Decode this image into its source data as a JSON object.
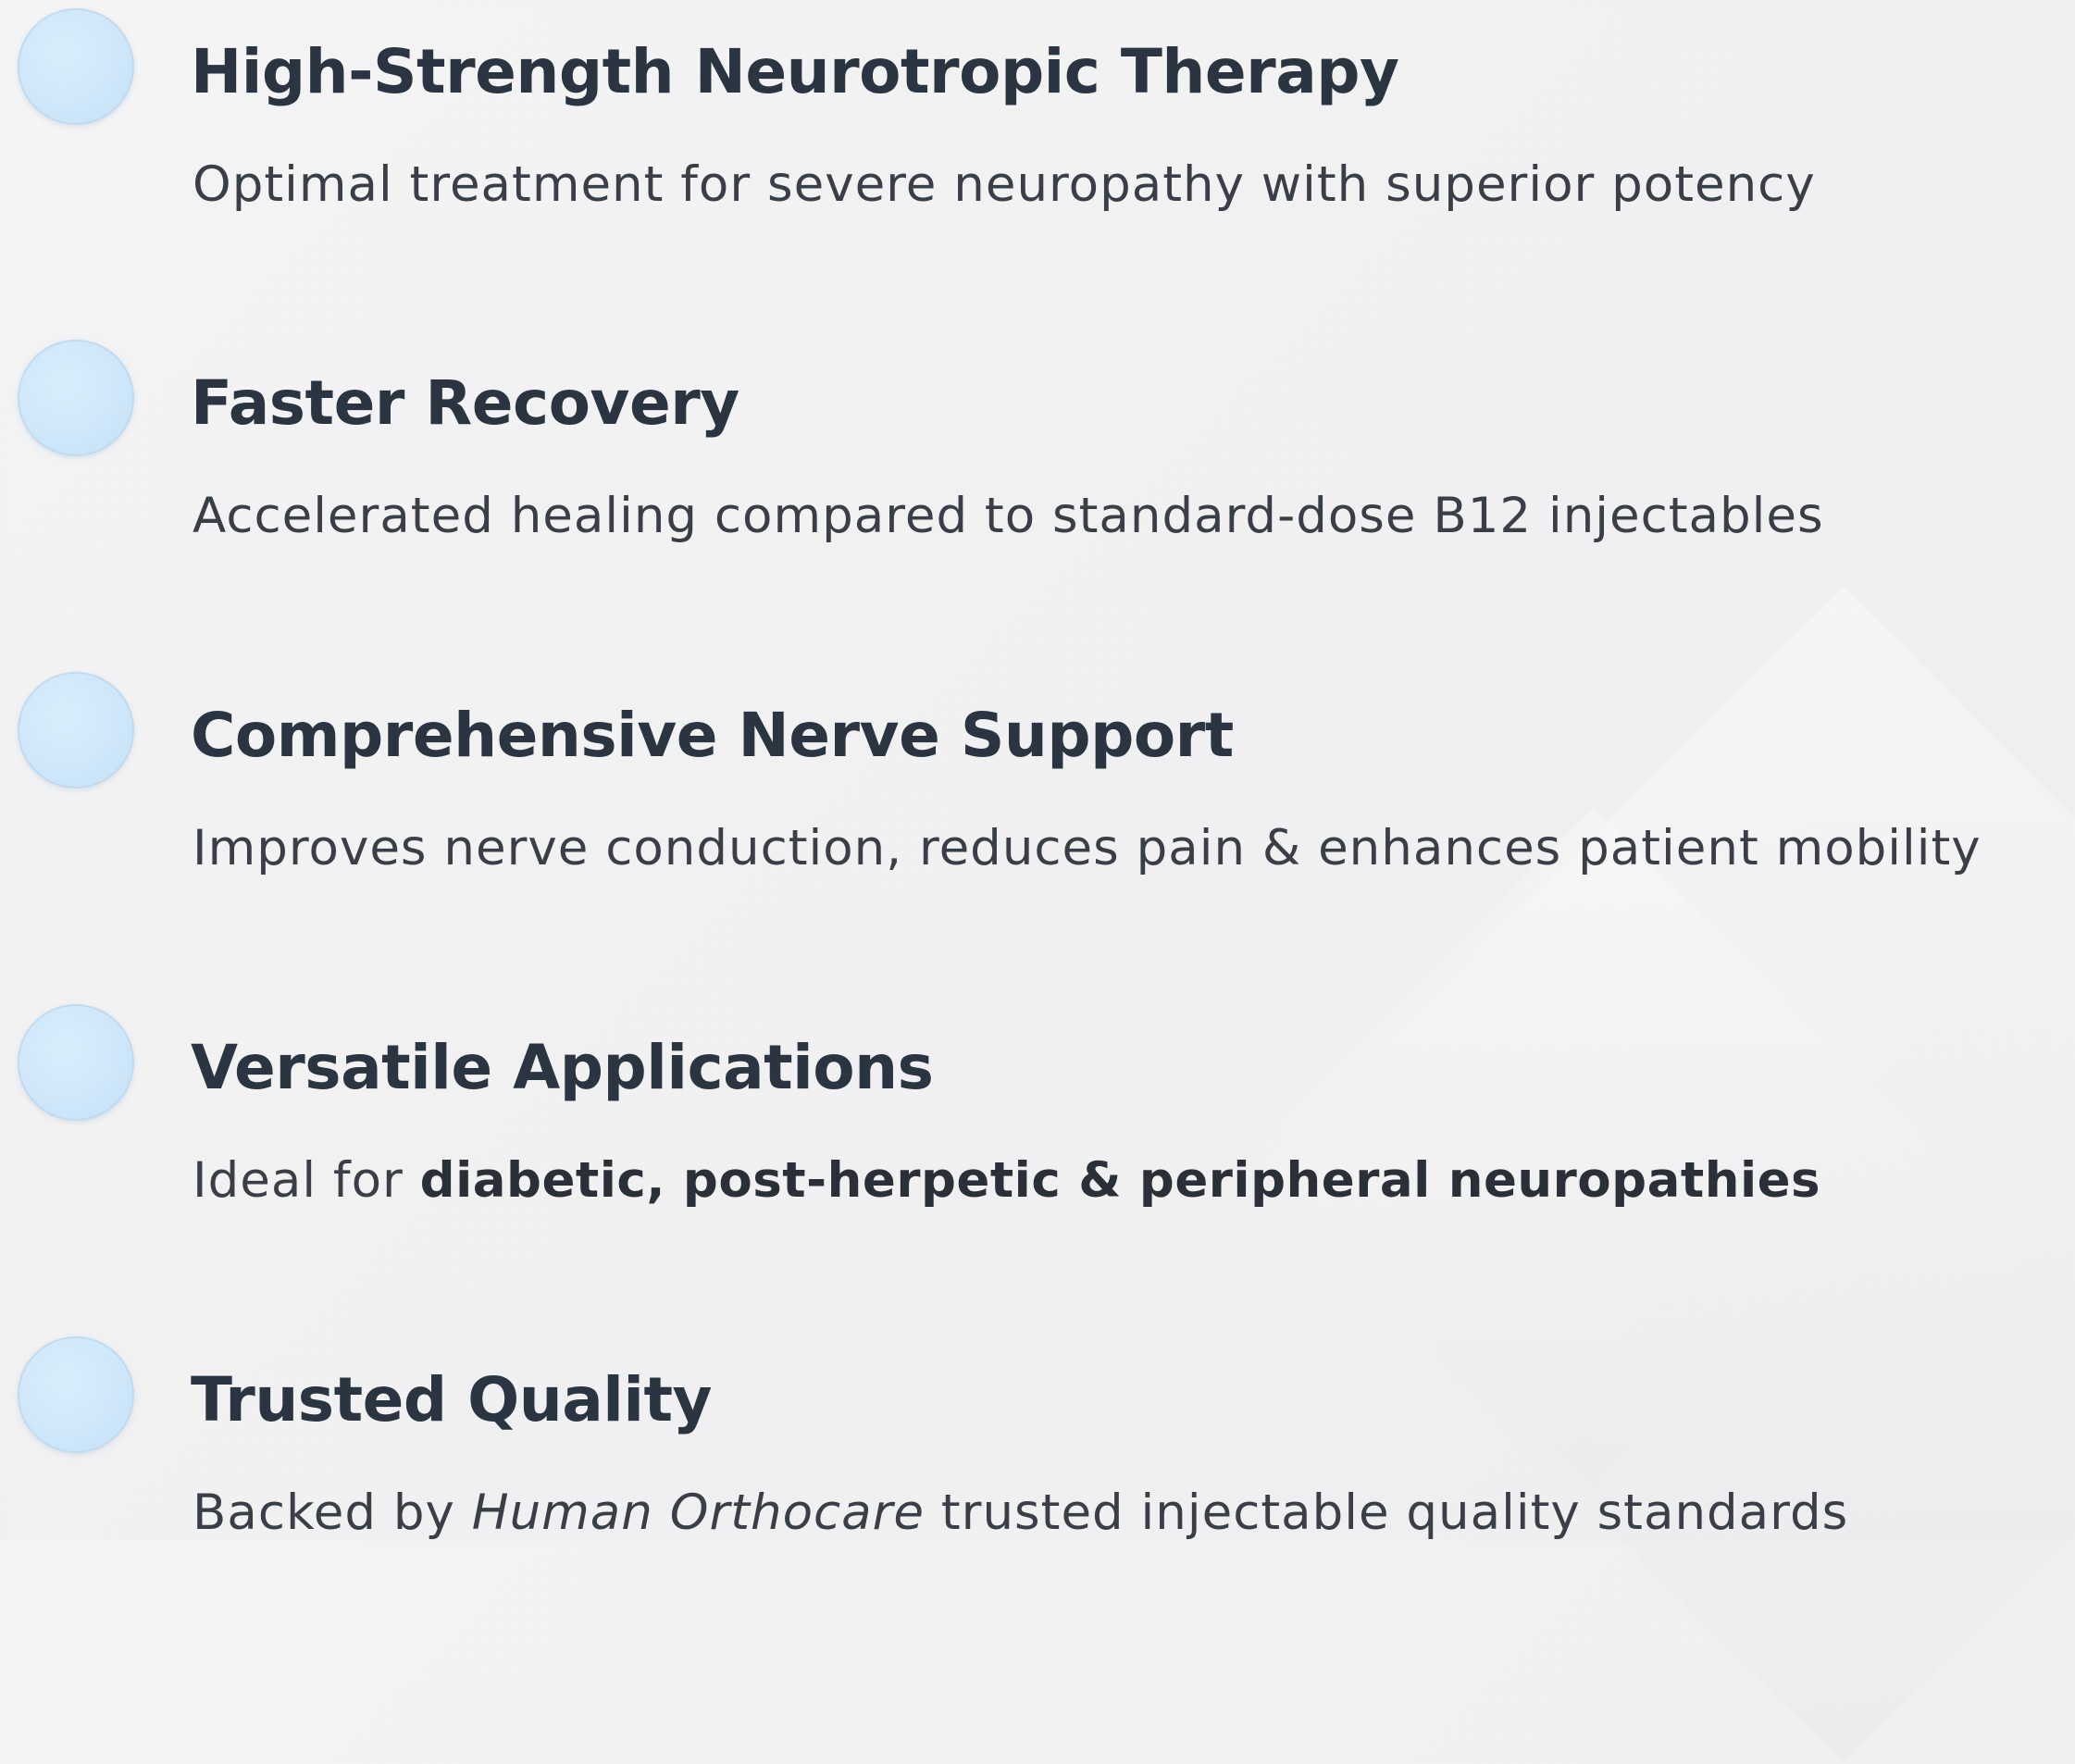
{
  "features": [
    {
      "title": "High-Strength Neurotropic Therapy",
      "desc": "Optimal treatment for severe neuropathy with superior potency"
    },
    {
      "title": "Faster Recovery",
      "desc": "Accelerated healing compared to standard-dose B12 injectables"
    },
    {
      "title": "Comprehensive Nerve Support",
      "desc": "Improves nerve conduction, reduces pain & enhances patient mobility"
    },
    {
      "title": "Versatile Applications",
      "desc_prefix": "Ideal for ",
      "desc_bold": "diabetic, post-herpetic & peripheral neuropathies"
    },
    {
      "title": "Trusted Quality",
      "desc_prefix": "Backed by ",
      "desc_italic": "Human Orthocare",
      "desc_suffix": " trusted injectable quality standards"
    }
  ],
  "colors": {
    "title": "#2b3542",
    "text": "#3a3f47",
    "bullet": "#cfe7fa",
    "background": "#f2f2f3"
  },
  "icons": {
    "bullet": "circle-bullet-icon"
  }
}
